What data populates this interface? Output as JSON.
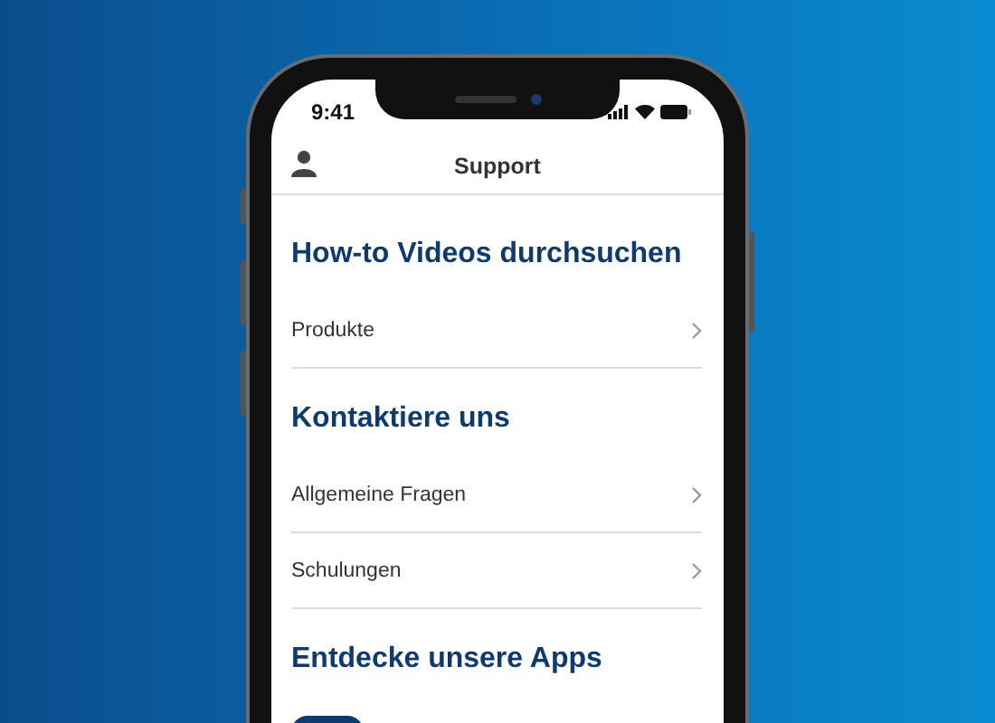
{
  "status_bar": {
    "time": "9:41"
  },
  "header": {
    "title": "Support"
  },
  "sections": [
    {
      "heading": "How-to Videos durchsuchen",
      "kind": "links",
      "rows": [
        {
          "label": "Produkte"
        }
      ]
    },
    {
      "heading": "Kontaktiere uns",
      "kind": "links",
      "rows": [
        {
          "label": "Allgemeine Fragen"
        },
        {
          "label": "Schulungen"
        }
      ]
    },
    {
      "heading": "Entdecke unsere Apps",
      "kind": "apps"
    }
  ]
}
